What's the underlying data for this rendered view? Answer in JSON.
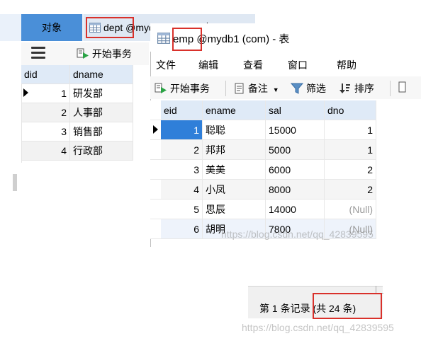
{
  "back_window": {
    "tab_objects": "对象",
    "tab_title": "dept @mydb1 (com) - 表",
    "tab_table_name": "dept",
    "start_transaction": "开始事务",
    "columns": [
      "did",
      "dname"
    ],
    "rows": [
      {
        "did": "1",
        "dname": "研发部"
      },
      {
        "did": "2",
        "dname": "人事部"
      },
      {
        "did": "3",
        "dname": "销售部"
      },
      {
        "did": "4",
        "dname": "行政部"
      }
    ]
  },
  "front_window": {
    "title_table": "emp",
    "title_rest": "@mydb1 (com) - 表",
    "menu": [
      "文件",
      "编辑",
      "查看",
      "窗口",
      "帮助"
    ],
    "toolbar": {
      "start_transaction": "开始事务",
      "memo": "备注",
      "filter": "筛选",
      "sort": "排序"
    },
    "columns": [
      "eid",
      "ename",
      "sal",
      "dno"
    ],
    "rows": [
      {
        "eid": "1",
        "ename": "聪聪",
        "sal": "15000",
        "dno": "1"
      },
      {
        "eid": "2",
        "ename": "邦邦",
        "sal": "5000",
        "dno": "1"
      },
      {
        "eid": "3",
        "ename": "美美",
        "sal": "6000",
        "dno": "2"
      },
      {
        "eid": "4",
        "ename": "小凤",
        "sal": "8000",
        "dno": "2"
      },
      {
        "eid": "5",
        "ename": "思辰",
        "sal": "14000",
        "dno": "(Null)"
      },
      {
        "eid": "6",
        "ename": "胡明",
        "sal": "7800",
        "dno": "(Null)"
      }
    ]
  },
  "status_bar": {
    "record_text": "第 1 条记录 (共 24 条)"
  },
  "watermarks": {
    "middle": "https://blog.csdn.net/qq_42839595",
    "bottom": "https://blog.csdn.net/qq_42839595"
  },
  "colors": {
    "highlight_box": "#d9312b",
    "selection": "#2f7fd9",
    "header_bg": "#dfeaf7"
  }
}
